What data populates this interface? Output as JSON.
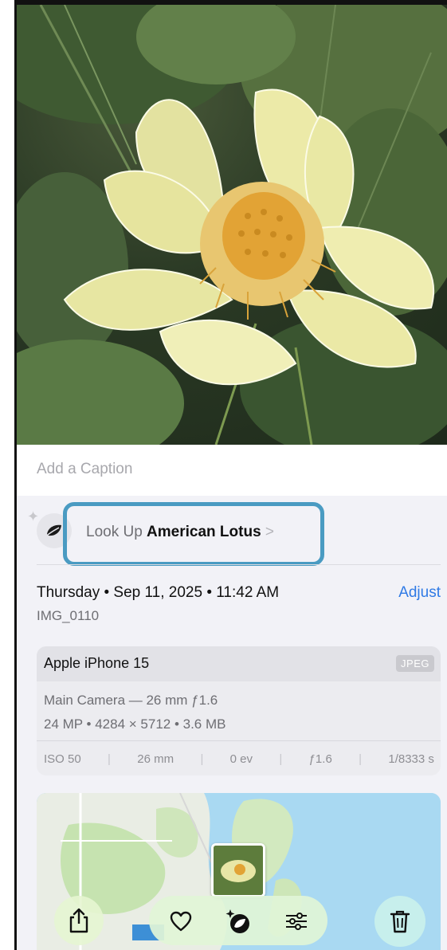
{
  "caption": {
    "placeholder": "Add a Caption"
  },
  "lookup": {
    "prefix": "Look Up ",
    "subject": "American Lotus",
    "chevron": ">"
  },
  "meta": {
    "date_line": "Thursday • Sep 11, 2025 • 11:42 AM",
    "adjust_label": "Adjust",
    "filename": "IMG_0110"
  },
  "camera": {
    "device": "Apple iPhone 15",
    "format": "JPEG",
    "lens": "Main Camera — 26 mm ƒ1.6",
    "specs": "24 MP • 4284 × 5712 • 3.6 MB",
    "exif": [
      {
        "label": "ISO 50"
      },
      {
        "label": "26 mm"
      },
      {
        "label": "0 ev"
      },
      {
        "label": "ƒ1.6"
      },
      {
        "label": "1/8333 s"
      }
    ]
  },
  "toolbar": {
    "share_icon": "share-icon",
    "favorite_icon": "heart-icon",
    "visual_lookup_icon": "visual-lookup-leaf-icon",
    "edit_icon": "sliders-icon",
    "delete_icon": "trash-icon"
  },
  "colors": {
    "accent": "#2f7ae5",
    "highlight": "#4a9bc2",
    "panel": "#f2f2f7"
  }
}
